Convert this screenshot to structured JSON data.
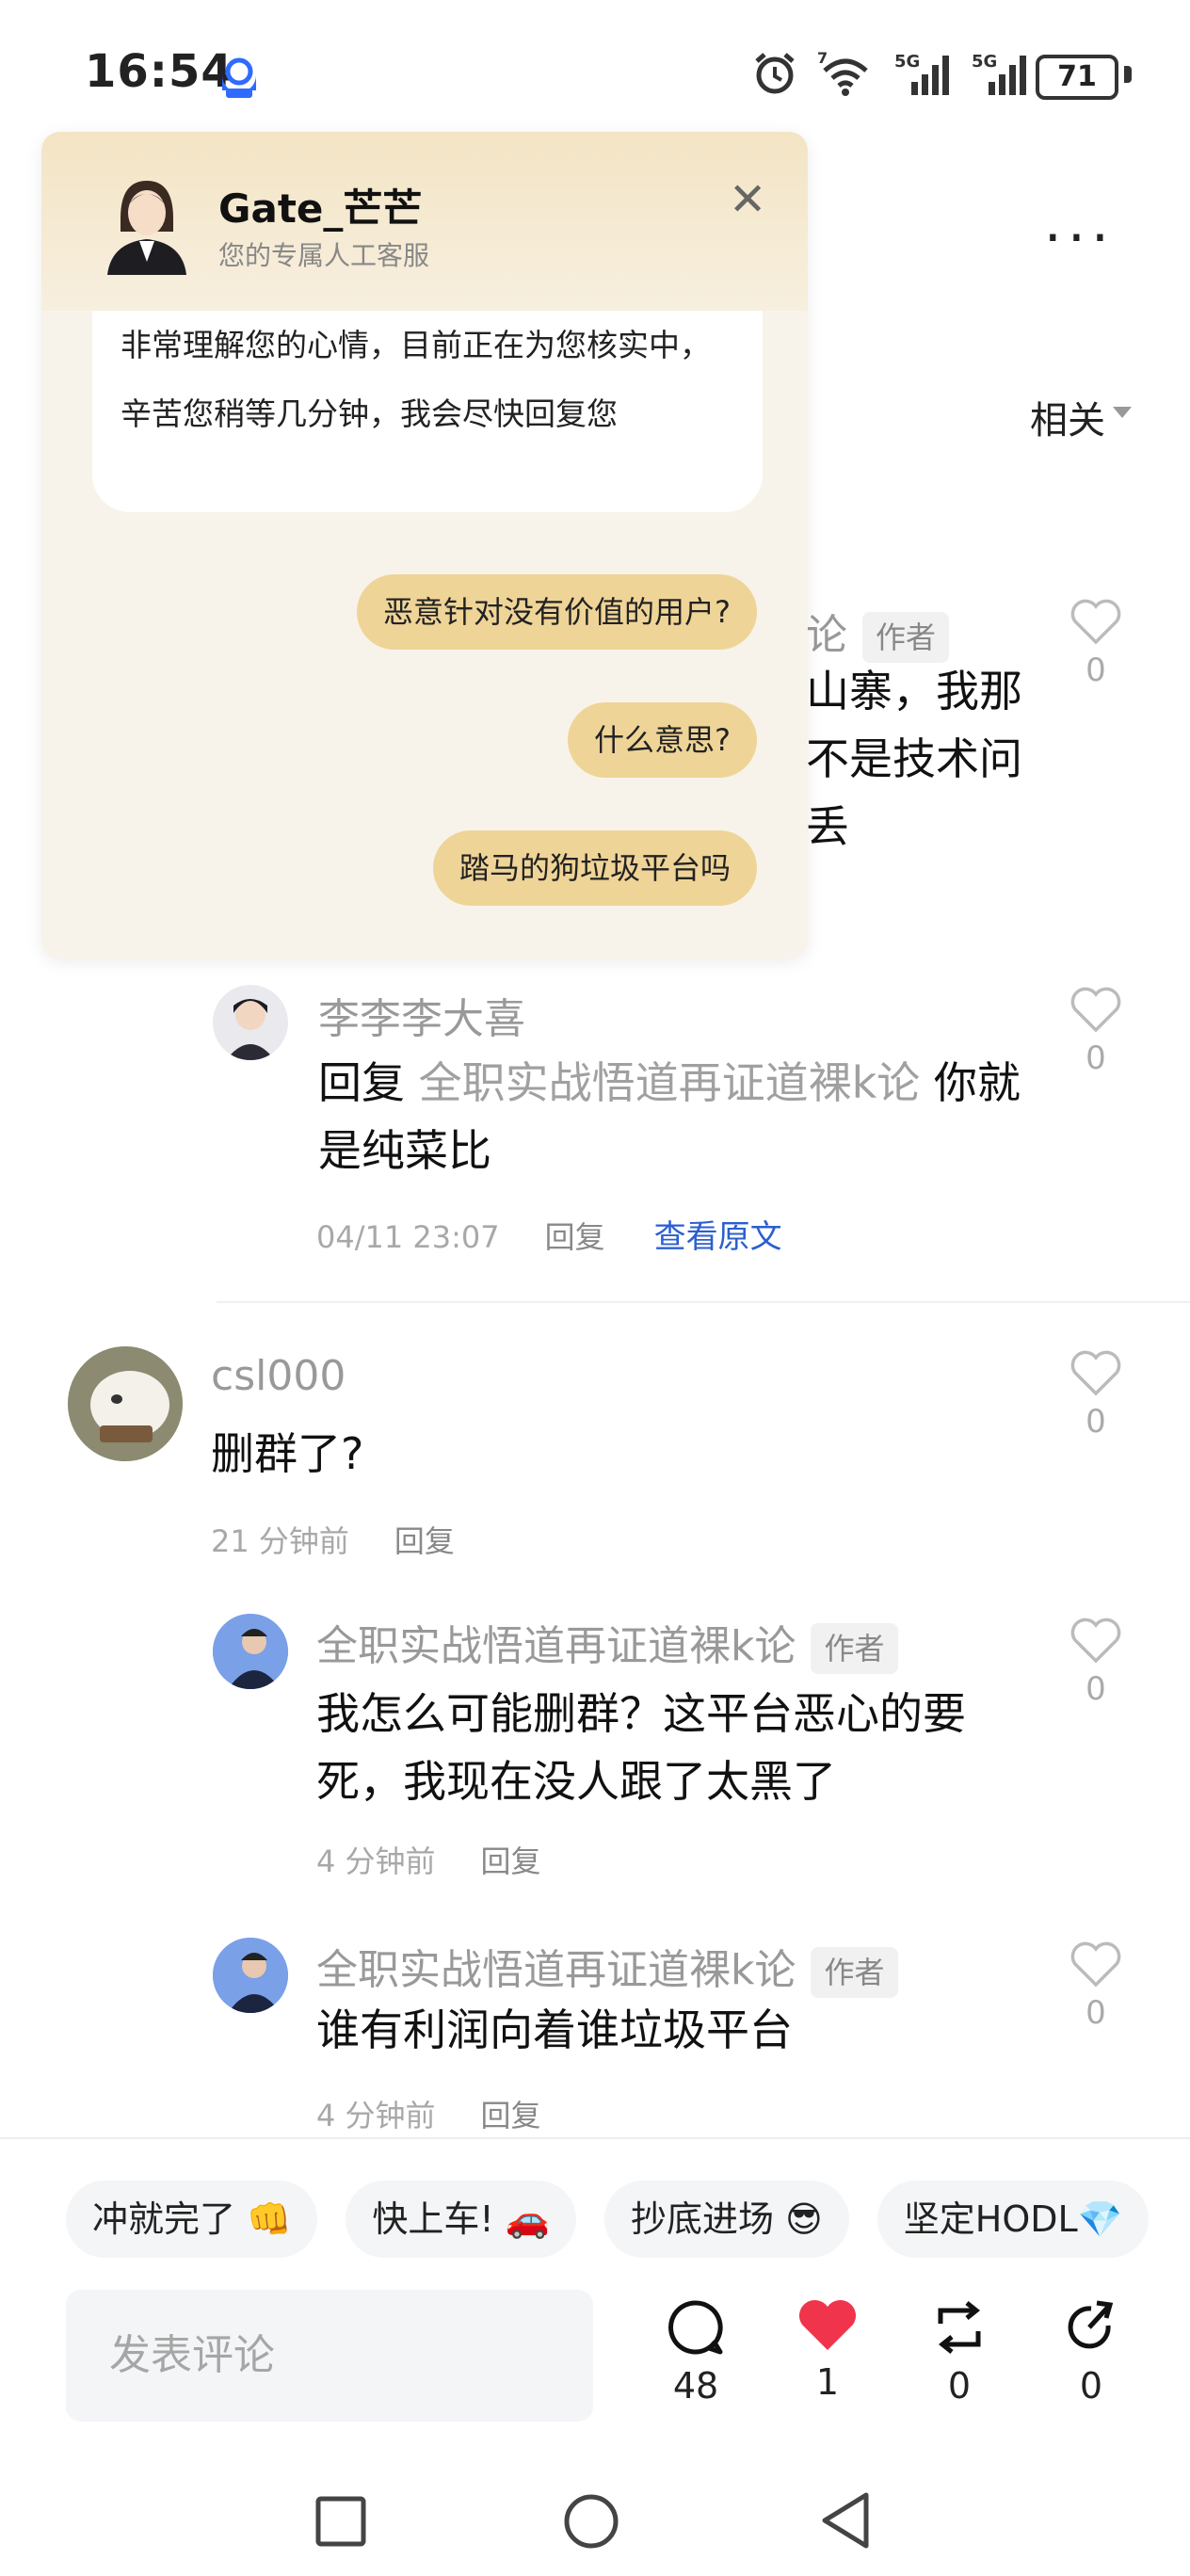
{
  "status_bar": {
    "time": "16:54",
    "battery": "71",
    "signal_1_label": "5G",
    "signal_2_label": "5G",
    "wifi_badge": "7"
  },
  "header": {
    "more_icon": "more-icon",
    "sort_label": "相关"
  },
  "chat_popup": {
    "agent_name": "Gate_芒芒",
    "agent_subtitle": "您的专属人工客服",
    "incoming_message": "非常理解您的心情，目前正在为您核实中，辛苦您稍等几分钟，我会尽快回复您",
    "outgoing_messages": [
      "恶意针对没有价值的用户?",
      "什么意思?",
      "踏马的狗垃圾平台吗"
    ]
  },
  "partial_comment": {
    "name_fragment": "论",
    "author_tag": "作者",
    "line1": "山寨，我那",
    "line2": "不是技术问",
    "line3": "丢",
    "likes": "0"
  },
  "comments": [
    {
      "name": "李李李大喜",
      "reply_prefix": "回复 ",
      "reply_target": "全职实战悟道再证道裸k论",
      "text": " 你就是纯菜比",
      "time": "04/11 23:07",
      "reply_label": "回复",
      "view_original": "查看原文",
      "likes": "0"
    },
    {
      "name": "csl000",
      "text": "删群了?",
      "time": "21 分钟前",
      "reply_label": "回复",
      "likes": "0"
    },
    {
      "name": "全职实战悟道再证道裸k论",
      "author_tag": "作者",
      "text": "我怎么可能删群？这平台恶心的要死，我现在没人跟了太黑了",
      "time": "4 分钟前",
      "reply_label": "回复",
      "likes": "0"
    },
    {
      "name": "全职实战悟道再证道裸k论",
      "author_tag": "作者",
      "text": "谁有利润向着谁垃圾平台",
      "time": "4 分钟前",
      "reply_label": "回复",
      "likes": "0"
    }
  ],
  "quick_replies": [
    "冲就完了 👊",
    "快上车! 🚗",
    "抄底进场 😎",
    "坚定HODL💎"
  ],
  "bottom_bar": {
    "input_placeholder": "发表评论",
    "comments_count": "48",
    "likes_count": "1",
    "reposts_count": "0",
    "shares_count": "0"
  },
  "colors": {
    "chat_header": "#f3e4c4",
    "chat_body": "#f8f3ea",
    "outgoing_bubble": "#efd497",
    "link_blue": "#2b5fd0",
    "like_red": "#f0344b"
  }
}
